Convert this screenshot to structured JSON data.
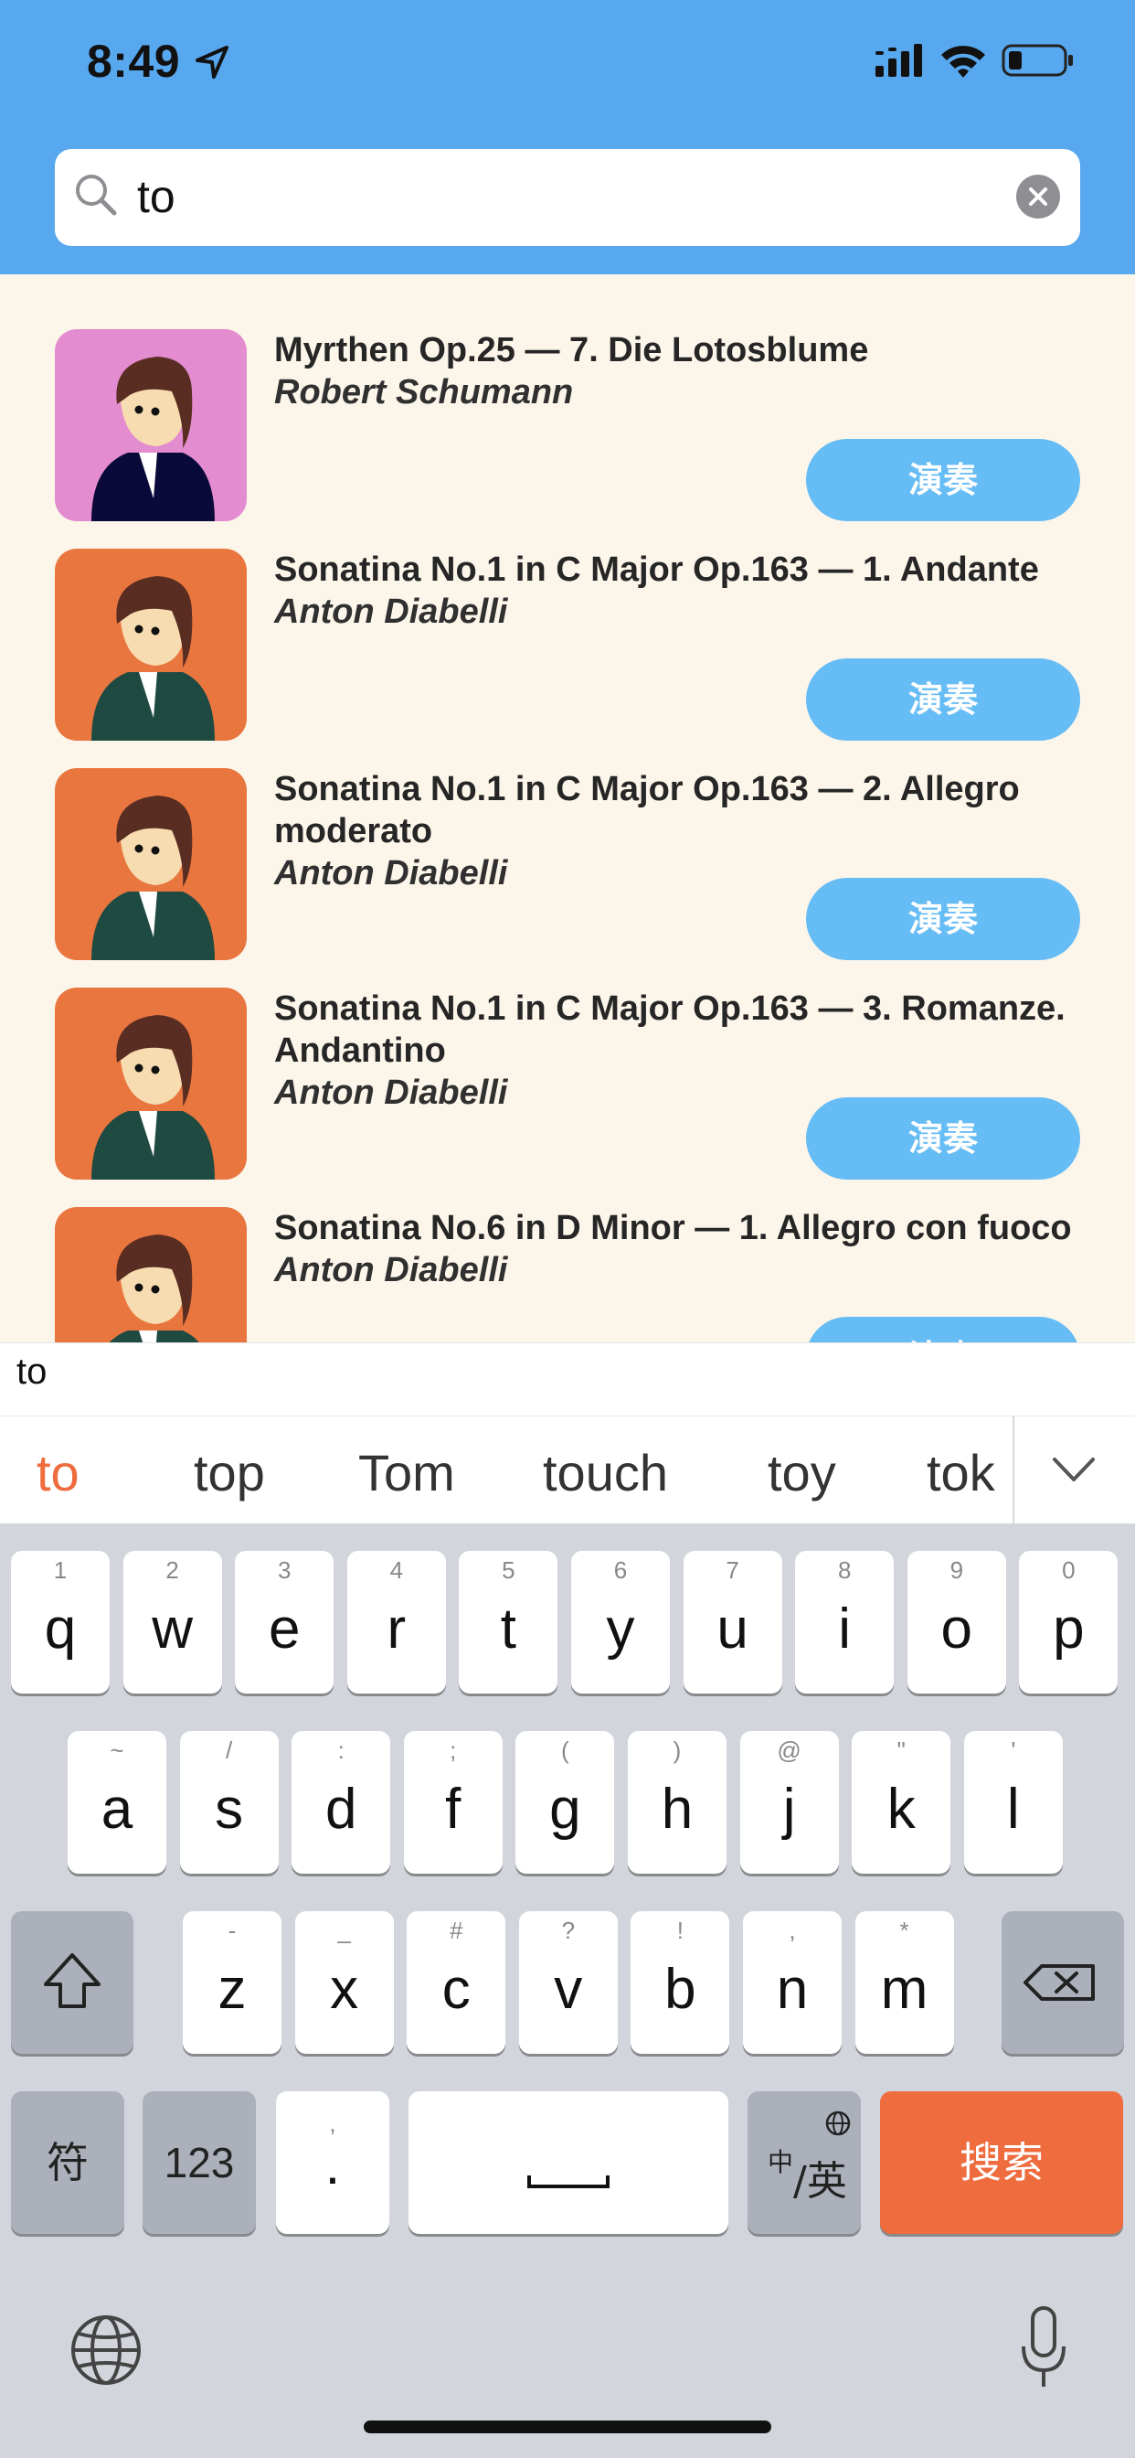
{
  "status": {
    "time": "8:49"
  },
  "search": {
    "query": "to"
  },
  "list": {
    "play_label": "演奏",
    "items": [
      {
        "title": "Myrthen Op.25 — 7. Die Lotosblume",
        "composer": "Robert Schumann",
        "avatar_color": "#e38ccf"
      },
      {
        "title": "Sonatina No.1 in C Major Op.163 — 1. Andante",
        "composer": "Anton Diabelli",
        "avatar_color": "#e8763e"
      },
      {
        "title": "Sonatina No.1 in C Major Op.163 — 2. Allegro moderato",
        "composer": "Anton Diabelli",
        "avatar_color": "#e8763e"
      },
      {
        "title": "Sonatina No.1 in C Major Op.163 — 3. Romanze. Andantino",
        "composer": "Anton Diabelli",
        "avatar_color": "#e8763e"
      },
      {
        "title": "Sonatina No.6 in D Minor — 1. Allegro con fuoco",
        "composer": "Anton Diabelli",
        "avatar_color": "#e8763e"
      }
    ]
  },
  "ime": {
    "composition": "to",
    "suggestions": [
      "to",
      "top",
      "Tom",
      "touch",
      "toy",
      "tok"
    ]
  },
  "keyboard": {
    "row1": [
      {
        "c": "q",
        "h": "1"
      },
      {
        "c": "w",
        "h": "2"
      },
      {
        "c": "e",
        "h": "3"
      },
      {
        "c": "r",
        "h": "4"
      },
      {
        "c": "t",
        "h": "5"
      },
      {
        "c": "y",
        "h": "6"
      },
      {
        "c": "u",
        "h": "7"
      },
      {
        "c": "i",
        "h": "8"
      },
      {
        "c": "o",
        "h": "9"
      },
      {
        "c": "p",
        "h": "0"
      }
    ],
    "row2": [
      {
        "c": "a",
        "h": "~"
      },
      {
        "c": "s",
        "h": "/"
      },
      {
        "c": "d",
        "h": ":"
      },
      {
        "c": "f",
        "h": ";"
      },
      {
        "c": "g",
        "h": "("
      },
      {
        "c": "h",
        "h": ")"
      },
      {
        "c": "j",
        "h": "@"
      },
      {
        "c": "k",
        "h": "\""
      },
      {
        "c": "l",
        "h": "'"
      }
    ],
    "row3": [
      {
        "c": "z",
        "h": "-"
      },
      {
        "c": "x",
        "h": "_"
      },
      {
        "c": "c",
        "h": "#"
      },
      {
        "c": "v",
        "h": "?"
      },
      {
        "c": "b",
        "h": "!"
      },
      {
        "c": "n",
        "h": ","
      },
      {
        "c": "m",
        "h": "*"
      }
    ],
    "symbols_label": "符",
    "numbers_label": "123",
    "punct_hint": ",",
    "punct_main": ".",
    "space_label": "␣",
    "lang_small": "中",
    "lang_main": "/英",
    "search_label": "搜索",
    "accent_color": "#ee6c3d"
  }
}
